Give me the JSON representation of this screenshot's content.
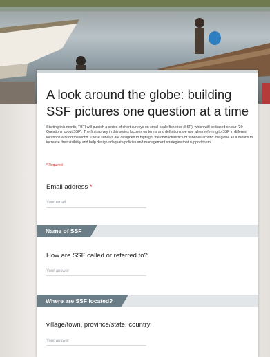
{
  "form": {
    "title": "A look around the globe: building SSF pictures one question at a time",
    "description": "Starting this month, TBTI will publish a series of short surveys on small-scale fisheries (SSF), which will be based on our \"20 Questions about SSF\". The first survey in this series focuses on terms and definitions we use when referring to SSF in different locations around the world. These surveys are designed to highlight the characteristics of fisheries around the globe as a means to increase their visibility and help design adequate policies and management strategies that support them.",
    "required_note": "* Required"
  },
  "email": {
    "label": "Email address",
    "asterisk": "*",
    "placeholder": "Your email"
  },
  "section1": {
    "title": "Name of SSF",
    "question": "How are SSF called or referred to?",
    "placeholder": "Your answer"
  },
  "section2": {
    "title": "Where are SSF located?",
    "question": "village/town, province/state, country",
    "placeholder": "Your answer"
  }
}
